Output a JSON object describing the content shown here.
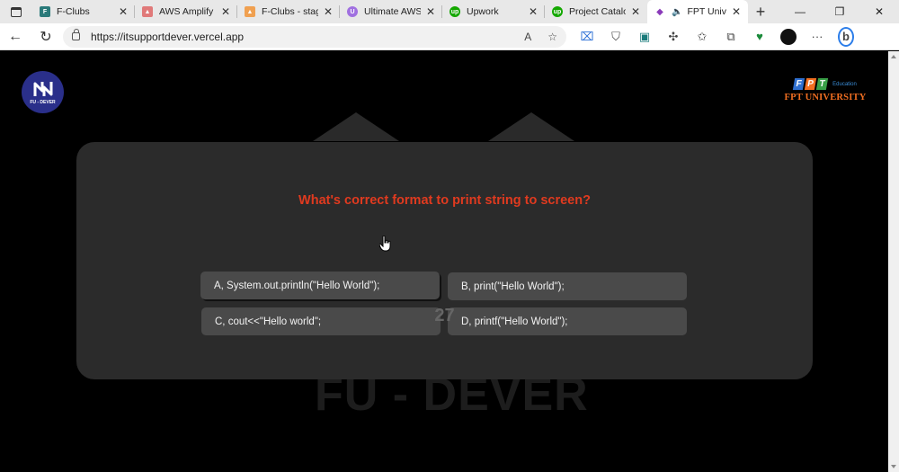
{
  "browser": {
    "tabs": [
      {
        "title": "F-Clubs",
        "favicon_color": "#2a7a7a",
        "favicon_char": "F"
      },
      {
        "title": "AWS Amplify c",
        "favicon_color": "#e07a7a",
        "favicon_char": "▲"
      },
      {
        "title": "F-Clubs - stagi",
        "favicon_color": "#f0a050",
        "favicon_char": "▲"
      },
      {
        "title": "Ultimate AWS (",
        "favicon_color": "#a070e0",
        "favicon_char": "U"
      },
      {
        "title": "Upwork",
        "favicon_color": "#14a800",
        "favicon_char": "up"
      },
      {
        "title": "Project Catalog",
        "favicon_color": "#14a800",
        "favicon_char": "up"
      },
      {
        "title": "FPT Unive",
        "favicon_color": "#8a3ab9",
        "favicon_char": "◆",
        "active": true
      }
    ],
    "new_tab": "+",
    "window_controls": [
      "—",
      "❐",
      "✕"
    ],
    "url": "https://itsupportdever.vercel.app"
  },
  "page": {
    "left_logo": {
      "caption": "FU - DEVER"
    },
    "right_logo": {
      "letters": [
        "F",
        "P",
        "T"
      ],
      "letter_colors": [
        "#2f6fcf",
        "#f26f21",
        "#3aa048"
      ],
      "education": "Education",
      "university": "FPT UNIVERSITY"
    },
    "background_text": "FU - DEVER",
    "quiz": {
      "question": "What's correct format to print string to screen?",
      "options": [
        "A, System.out.println(\"Hello World\");",
        "B, print(\"Hello World\");",
        "C, cout<<\"Hello world\";",
        "D, printf(\"Hello World\");"
      ],
      "timer": "27"
    }
  },
  "colors": {
    "question": "#e03a1f",
    "card": "#2b2b2b",
    "option": "#4a4a4a"
  }
}
